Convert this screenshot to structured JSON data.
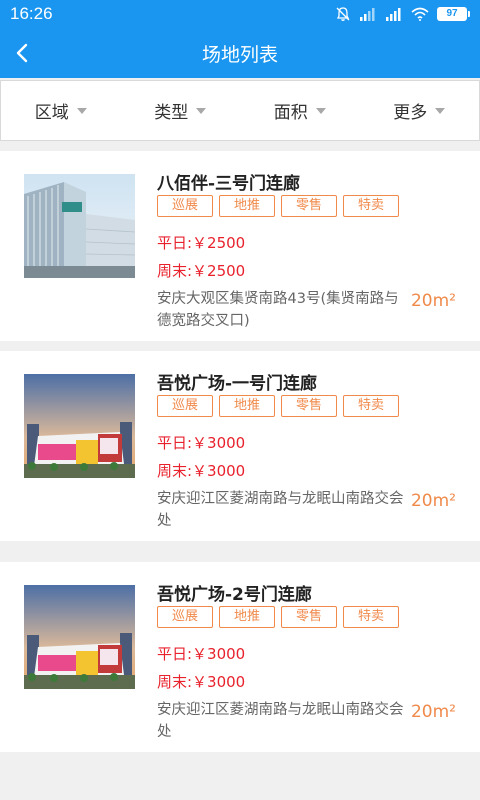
{
  "status": {
    "time": "16:26",
    "battery": "97"
  },
  "navbar": {
    "title": "场地列表"
  },
  "filters": [
    {
      "label": "区域"
    },
    {
      "label": "类型"
    },
    {
      "label": "面积"
    },
    {
      "label": "更多"
    }
  ],
  "colors": {
    "brand": "#1a96f0",
    "tag_orange": "#f08a4b",
    "price_red": "#e8212c"
  },
  "venues": [
    {
      "name": "八佰伴-三号门连廊",
      "tags": [
        "巡展",
        "地推",
        "零售",
        "特卖"
      ],
      "weekday": "平日:￥2500",
      "weekend": "周末:￥2500",
      "address": "安庆大观区集贤南路43号(集贤南路与德宽路交叉口)",
      "area": "20m²"
    },
    {
      "name": "吾悦广场-一号门连廊",
      "tags": [
        "巡展",
        "地推",
        "零售",
        "特卖"
      ],
      "weekday": "平日:￥3000",
      "weekend": "周末:￥3000",
      "address": "安庆迎江区菱湖南路与龙眠山南路交会处",
      "area": "20m²"
    },
    {
      "name": "吾悦广场-2号门连廊",
      "tags": [
        "巡展",
        "地推",
        "零售",
        "特卖"
      ],
      "weekday": "平日:￥3000",
      "weekend": "周末:￥3000",
      "address": "安庆迎江区菱湖南路与龙眠山南路交会处",
      "area": "20m²"
    }
  ]
}
